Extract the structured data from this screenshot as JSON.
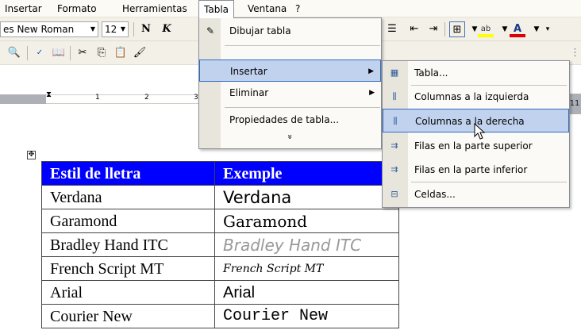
{
  "menubar": {
    "items": [
      "Insertar",
      "Formato",
      "Herramientas",
      "Tabla",
      "Ventana",
      "?"
    ]
  },
  "toolbar": {
    "font_name": "es New Roman",
    "font_size": "12",
    "bold_label": "N",
    "italic_label": "K",
    "font_color_label": "A",
    "highlight_label": "ab"
  },
  "ruler": {
    "numbers": [
      "1",
      "2",
      "3"
    ],
    "right_number": "11"
  },
  "tabla_menu": {
    "items": [
      {
        "label": "Dibujar tabla",
        "icon": "pencil-table-icon"
      },
      {
        "label": "Insertar",
        "icon": "",
        "has_submenu": true
      },
      {
        "label": "Eliminar",
        "icon": "",
        "has_submenu": true
      },
      {
        "label": "Propiedades de tabla...",
        "icon": ""
      }
    ],
    "expand_glyph": "»"
  },
  "insertar_submenu": {
    "items": [
      {
        "label": "Tabla...",
        "icon": "table-icon"
      },
      {
        "label": "Columnas a la izquierda",
        "icon": "columns-left-icon"
      },
      {
        "label": "Columnas a la derecha",
        "icon": "columns-right-icon"
      },
      {
        "label": "Filas en la parte superior",
        "icon": "rows-above-icon"
      },
      {
        "label": "Filas en la parte inferior",
        "icon": "rows-below-icon"
      },
      {
        "label": "Celdas...",
        "icon": "cells-icon"
      }
    ]
  },
  "doc_table": {
    "header": [
      "Estil de lletra",
      "Exemple"
    ],
    "rows": [
      [
        "Verdana",
        "Verdana"
      ],
      [
        "Garamond",
        "Garamond"
      ],
      [
        "Bradley Hand ITC",
        "Bradley Hand ITC"
      ],
      [
        "French Script MT",
        "French Script MT"
      ],
      [
        "Arial",
        "Arial"
      ],
      [
        "Courier New",
        "Courier New"
      ]
    ],
    "header_color": "#0000ff"
  }
}
